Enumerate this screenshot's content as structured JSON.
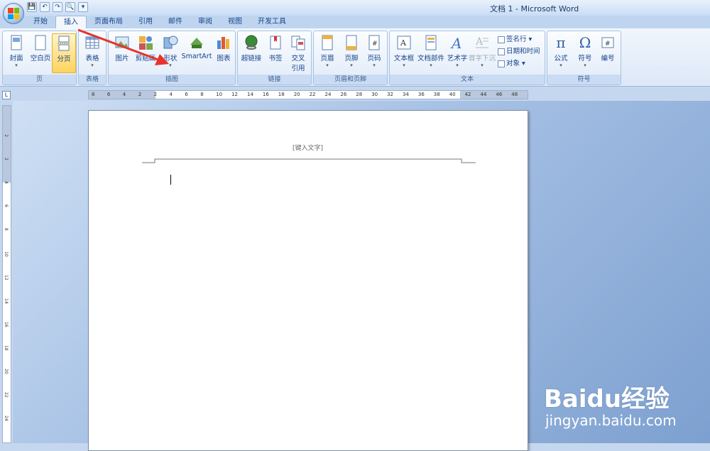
{
  "window": {
    "title": "文档 1 - Microsoft Word"
  },
  "qat": {
    "save": "💾",
    "undo": "↶",
    "redo": "↷",
    "print_preview": "🔍",
    "customize": "▾"
  },
  "tabs": [
    "开始",
    "插入",
    "页面布局",
    "引用",
    "邮件",
    "审阅",
    "视图",
    "开发工具"
  ],
  "active_tab": "插入",
  "ribbon": {
    "groups": {
      "pages": {
        "label": "页",
        "buttons": [
          "封面",
          "空白页",
          "分页"
        ]
      },
      "tables": {
        "label": "表格",
        "buttons": [
          "表格"
        ]
      },
      "illustrations": {
        "label": "插图",
        "buttons": [
          "图片",
          "剪贴画",
          "形状",
          "SmartArt",
          "图表"
        ]
      },
      "links": {
        "label": "链接",
        "buttons": [
          "超链接",
          "书签",
          "交叉",
          "引用"
        ]
      },
      "header_footer": {
        "label": "页眉和页脚",
        "buttons": [
          "页眉",
          "页脚",
          "页码"
        ]
      },
      "text": {
        "label": "文本",
        "buttons": [
          "文本框",
          "文档部件",
          "艺术字",
          "首字下沉"
        ],
        "small": [
          "签名行",
          "日期和时间",
          "对象"
        ]
      },
      "symbols": {
        "label": "符号",
        "buttons": [
          "公式",
          "符号",
          "编号"
        ]
      }
    }
  },
  "ruler": {
    "corner": "L",
    "h_ticks": [
      "8",
      "6",
      "4",
      "2",
      "2",
      "4",
      "6",
      "8",
      "10",
      "12",
      "14",
      "16",
      "18",
      "20",
      "22",
      "24",
      "26",
      "28",
      "30",
      "32",
      "34",
      "36",
      "38",
      "40",
      "42",
      "44",
      "46",
      "48"
    ],
    "v_ticks": [
      "2",
      "2",
      "4",
      "6",
      "8",
      "10",
      "12",
      "14",
      "16",
      "18",
      "20",
      "22",
      "24"
    ]
  },
  "document": {
    "header_placeholder": "[键入文字]"
  },
  "watermark": {
    "logo": "Baidu经验",
    "site": "jingyan.baidu.com"
  },
  "colors": {
    "accent": "#15428b",
    "arrow": "#e8332c",
    "selected_button": "#ffd35e"
  }
}
